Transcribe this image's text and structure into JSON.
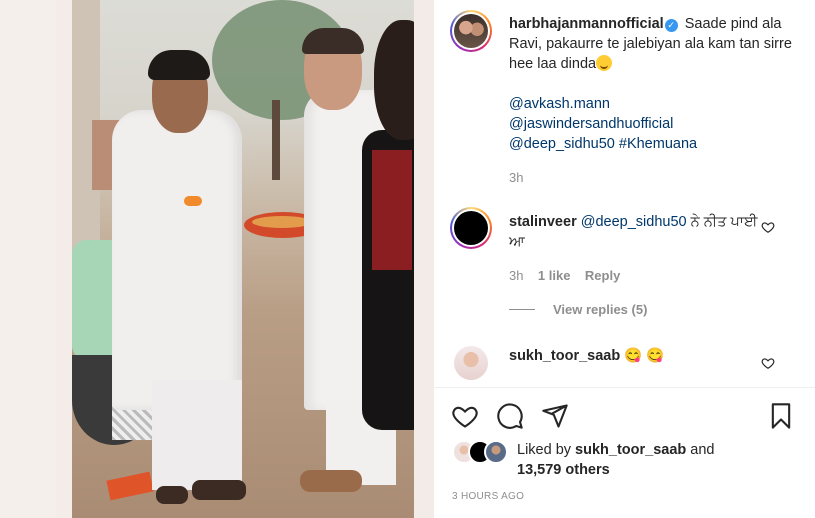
{
  "post": {
    "author": "harbhajanmannofficial",
    "caption_text": "Saade pind ala Ravi, pakaurre te jalebiyan ala kam tan sirre hee laa dinda",
    "mentions": [
      "@avkash.mann",
      "@jaswindersandhuofficial",
      "@deep_sidhu50"
    ],
    "hashtag": "#Khemuana",
    "caption_time": "3h"
  },
  "comments": [
    {
      "username": "stalinveer",
      "mention": "@deep_sidhu50",
      "text": "ਨੇ ਨੀਤ ਪਾਈ ਆ",
      "time": "3h",
      "likes": "1 like",
      "reply_label": "Reply",
      "view_replies": "View replies (5)"
    },
    {
      "username": "sukh_toor_saab",
      "emoji": "😋 😋"
    }
  ],
  "likes": {
    "prefix": "Liked by",
    "user": "sukh_toor_saab",
    "and": "and",
    "others": "13,579 others"
  },
  "timestamp": "3 HOURS AGO",
  "icons": {
    "like": "heart-icon",
    "comment": "comment-bubble-icon",
    "share": "paper-plane-icon",
    "save": "bookmark-icon",
    "verified": "verified-badge-icon"
  },
  "colors": {
    "link": "#00376b",
    "verified": "#3897f0",
    "muted": "#8e8e8e"
  }
}
